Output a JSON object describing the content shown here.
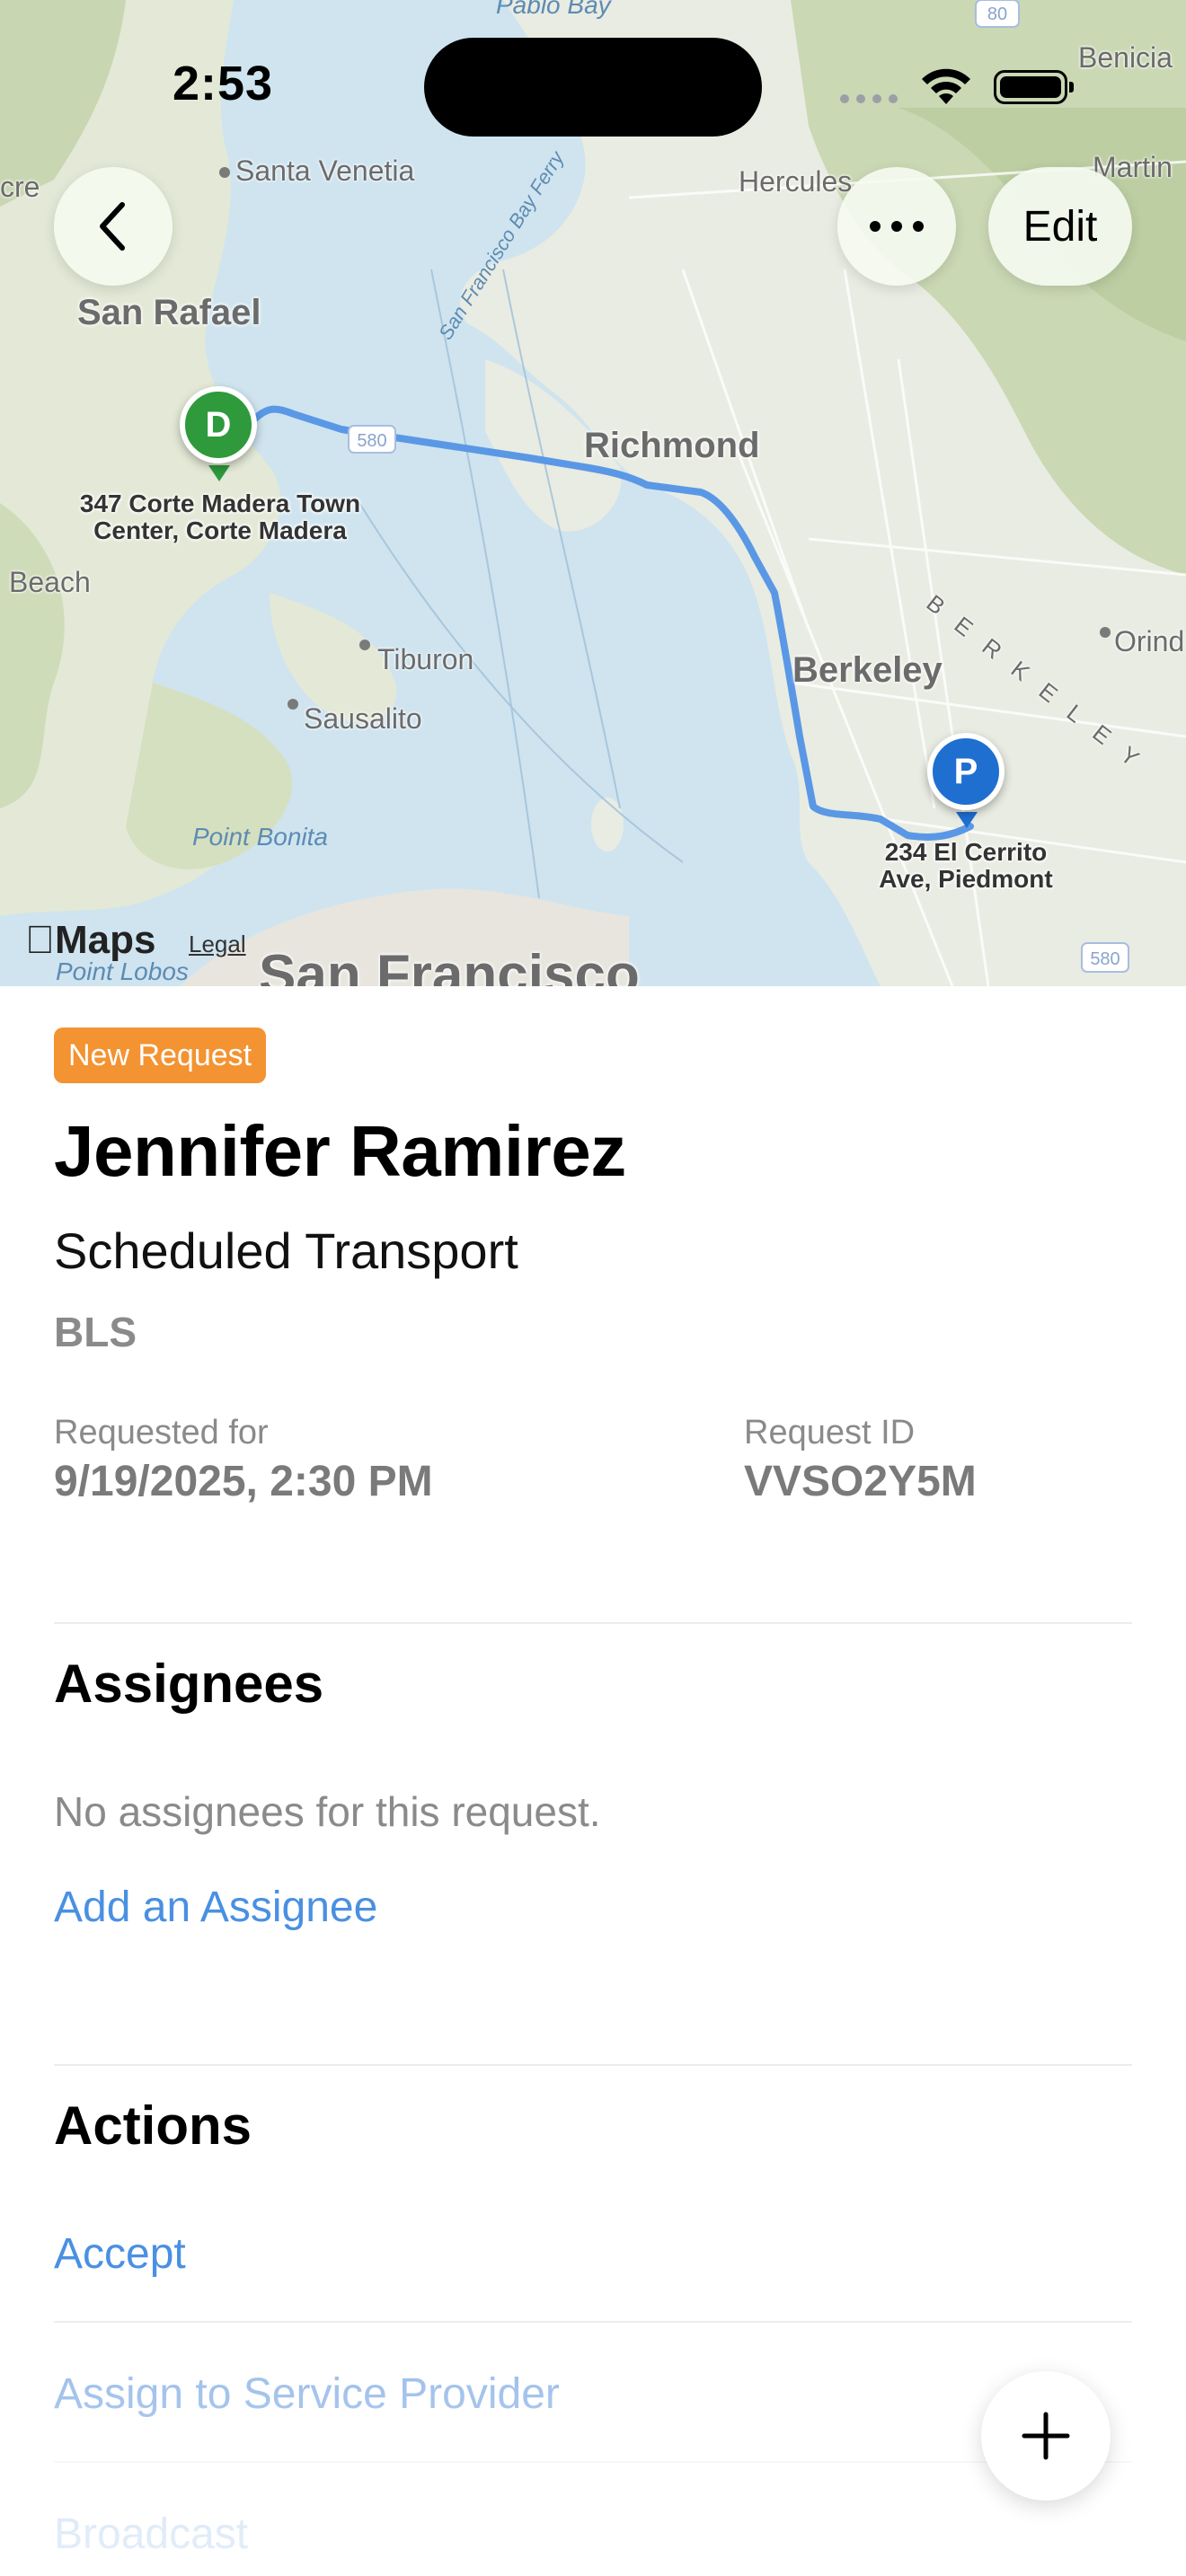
{
  "status_bar": {
    "time": "2:53"
  },
  "map": {
    "buttons": {
      "edit_label": "Edit"
    },
    "labels": {
      "san_rafael": "San Rafael",
      "santa_venetia": "Santa Venetia",
      "richmond": "Richmond",
      "berkeley": "Berkeley",
      "berkeley_rotated": "BERKELEY",
      "tiburon": "Tiburon",
      "sausalito": "Sausalito",
      "point_bonita": "Point Bonita",
      "point_lobos": "Point Lobos",
      "san_francisco": "San Francisco",
      "hercules": "Hercules",
      "benicia": "Benicia",
      "martinez": "Martin",
      "orinda": "Orind",
      "beach": "Beach",
      "bay_ferry": "San Francisco Bay Ferry",
      "pablo_bay": "Pablo Bay",
      "cre": "cre",
      "hwy_580a": "580",
      "hwy_580b": "580",
      "hwy_80": "80"
    },
    "dropoff": {
      "letter": "D",
      "address": "347 Corte Madera Town Center, Corte Madera"
    },
    "pickup": {
      "letter": "P",
      "address": "234 El Cerrito Ave, Piedmont"
    },
    "attribution": {
      "brand": "Maps",
      "legal": "Legal"
    },
    "colors": {
      "route": "#5a98e6",
      "dropoff_pin": "#2e9a3c",
      "pickup_pin": "#1f6fd1",
      "water": "#cfe4ef",
      "land": "#e8ecdf"
    }
  },
  "request": {
    "badge": "New Request",
    "patient_name": "Jennifer Ramirez",
    "transport_type": "Scheduled Transport",
    "level": "BLS",
    "requested_for_label": "Requested for",
    "requested_for_value": "9/19/2025, 2:30 PM",
    "request_id_label": "Request ID",
    "request_id_value": "VVSO2Y5M",
    "badge_color": "#f39331"
  },
  "assignees": {
    "title": "Assignees",
    "empty_text": "No assignees for this request.",
    "add_link": "Add an Assignee"
  },
  "actions": {
    "title": "Actions",
    "items": [
      "Accept",
      "Assign to Service Provider",
      "Broadcast"
    ],
    "link_color": "#4a90e2"
  }
}
